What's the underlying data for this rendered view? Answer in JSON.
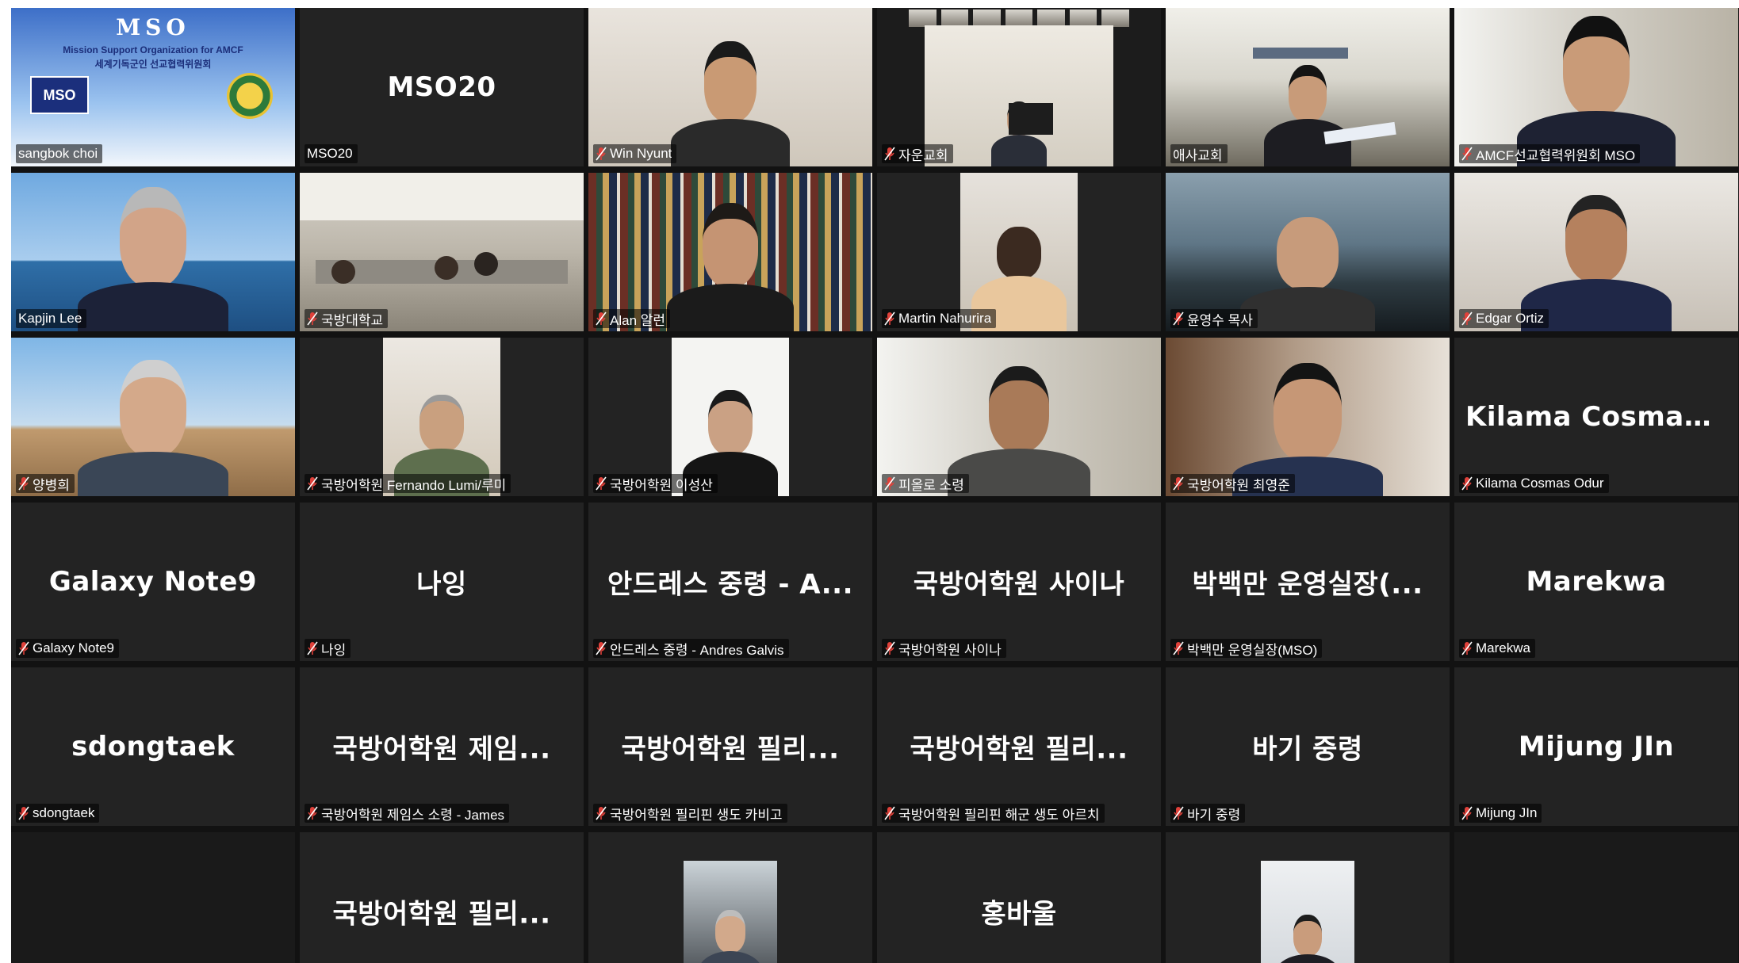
{
  "colors": {
    "active_speaker_border": "#b3e05a",
    "muted_mic": "#e0413a",
    "tile_bg": "#232323",
    "gallery_bg": "#121212"
  },
  "icons": {
    "muted": "muted-mic-icon"
  },
  "logo": {
    "title": "MSO",
    "subtitle_en": "Mission Support Organization for AMCF",
    "subtitle_ko": "세계기독군인 선교협력위원회",
    "badge": "MSO"
  },
  "tiles": [
    {
      "label": "sangbok choi",
      "big": "",
      "video": true,
      "muted": false
    },
    {
      "label": "MSO20",
      "big": "MSO20",
      "video": false,
      "muted": false
    },
    {
      "label": "Win Nyunt",
      "big": "",
      "video": true,
      "muted": true
    },
    {
      "label": "자운교회",
      "big": "",
      "video": true,
      "muted": true
    },
    {
      "label": "애사교회",
      "big": "",
      "video": true,
      "muted": false,
      "active": true
    },
    {
      "label": "AMCF선교협력위원회 MSO",
      "big": "",
      "video": true,
      "muted": true
    },
    {
      "label": "Kapjin Lee",
      "big": "",
      "video": true,
      "muted": false
    },
    {
      "label": "국방대학교",
      "big": "",
      "video": true,
      "muted": true
    },
    {
      "label": "Alan 알런",
      "big": "",
      "video": true,
      "muted": true
    },
    {
      "label": "Martin Nahurira",
      "big": "",
      "video": true,
      "muted": true
    },
    {
      "label": "윤영수 목사",
      "big": "",
      "video": true,
      "muted": true
    },
    {
      "label": "Edgar Ortiz",
      "big": "",
      "video": true,
      "muted": true
    },
    {
      "label": "양병희",
      "big": "",
      "video": true,
      "muted": true
    },
    {
      "label": "국방어학원 Fernando Lumi/루미",
      "big": "",
      "video": true,
      "muted": true
    },
    {
      "label": "국방어학원 이성산",
      "big": "",
      "video": true,
      "muted": true
    },
    {
      "label": "피올로 소령",
      "big": "",
      "video": true,
      "muted": true
    },
    {
      "label": "국방어학원 최영준",
      "big": "",
      "video": true,
      "muted": true
    },
    {
      "label": "Kilama Cosmas Odur",
      "big": "Kilama Cosmas...",
      "video": false,
      "muted": true
    },
    {
      "label": "Galaxy Note9",
      "big": "Galaxy Note9",
      "video": false,
      "muted": true
    },
    {
      "label": "나잉",
      "big": "나잉",
      "video": false,
      "muted": true
    },
    {
      "label": "안드레스 중령 - Andres Galvis",
      "big": "안드레스 중령 - A...",
      "video": false,
      "muted": true
    },
    {
      "label": "국방어학원 사이나",
      "big": "국방어학원 사이나",
      "video": false,
      "muted": true
    },
    {
      "label": "박백만 운영실장(MSO)",
      "big": "박백만 운영실장(...",
      "video": false,
      "muted": true
    },
    {
      "label": "Marekwa",
      "big": "Marekwa",
      "video": false,
      "muted": true
    },
    {
      "label": "sdongtaek",
      "big": "sdongtaek",
      "video": false,
      "muted": true
    },
    {
      "label": "국방어학원 제임스 소령 - James",
      "big": "국방어학원 제임...",
      "video": false,
      "muted": true
    },
    {
      "label": "국방어학원 필리핀 생도 카비고",
      "big": "국방어학원 필리...",
      "video": false,
      "muted": true
    },
    {
      "label": "국방어학원 필리핀 해군 생도 아르치",
      "big": "국방어학원 필리...",
      "video": false,
      "muted": true
    },
    {
      "label": "바기 중령",
      "big": "바기 중령",
      "video": false,
      "muted": true
    },
    {
      "label": "Mijung JIn",
      "big": "Mijung JIn",
      "video": false,
      "muted": true
    },
    {
      "label": "",
      "big": "",
      "video": false,
      "muted": false,
      "empty": true
    },
    {
      "label": "",
      "big": "국방어학원 필리...",
      "video": false,
      "muted": false
    },
    {
      "label": "",
      "big": "",
      "video": true,
      "muted": false
    },
    {
      "label": "",
      "big": "홍바울",
      "video": false,
      "muted": false
    },
    {
      "label": "",
      "big": "",
      "video": true,
      "muted": false
    },
    {
      "label": "",
      "big": "",
      "video": false,
      "muted": false,
      "empty": true
    }
  ]
}
